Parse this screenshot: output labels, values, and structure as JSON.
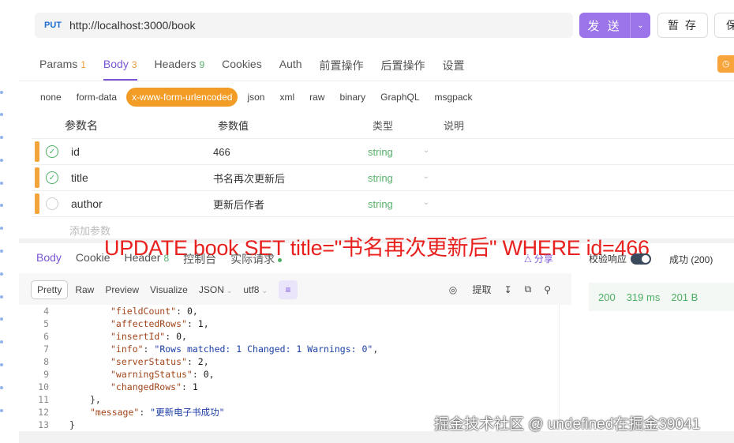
{
  "request": {
    "method": "PUT",
    "url": "http://localhost:3000/book",
    "send_label": "发 送",
    "save_label": "暂 存",
    "save2_label": "保"
  },
  "req_tabs": [
    {
      "label": "Params",
      "count": "1"
    },
    {
      "label": "Body",
      "count": "3"
    },
    {
      "label": "Headers",
      "count": "9"
    },
    {
      "label": "Cookies",
      "count": ""
    },
    {
      "label": "Auth",
      "count": ""
    },
    {
      "label": "前置操作",
      "count": ""
    },
    {
      "label": "后置操作",
      "count": ""
    },
    {
      "label": "设置",
      "count": ""
    }
  ],
  "body_types": [
    "none",
    "form-data",
    "x-www-form-urlencoded",
    "json",
    "xml",
    "raw",
    "binary",
    "GraphQL",
    "msgpack"
  ],
  "params_table": {
    "headers": {
      "name": "参数名",
      "value": "参数值",
      "type": "类型",
      "desc": "说明"
    },
    "rows": [
      {
        "name": "id",
        "value": "466",
        "type": "string",
        "checked": true
      },
      {
        "name": "title",
        "value": "书名再次更新后",
        "type": "string",
        "checked": true
      },
      {
        "name": "author",
        "value": "更新后作者",
        "type": "string",
        "checked": false
      }
    ],
    "add_placeholder": "添加参数"
  },
  "annotation": "UPDATE book SET title=\"书名再次更新后\" WHERE id=466",
  "resp_tabs": {
    "body": "Body",
    "cookie": "Cookie",
    "header": "Header",
    "header_count": "8",
    "console": "控制台",
    "actual": "实际请求",
    "share": "分享"
  },
  "validate": {
    "label": "校验响应",
    "status": "成功 (200)"
  },
  "view_bar": {
    "pretty": "Pretty",
    "raw": "Raw",
    "preview": "Preview",
    "visualize": "Visualize",
    "format": "JSON",
    "encoding": "utf8",
    "extract": "提取"
  },
  "code_lines": [
    {
      "n": "4",
      "indent": 2,
      "key": "fieldCount",
      "val": "0",
      "kind": "num",
      "comma": true
    },
    {
      "n": "5",
      "indent": 2,
      "key": "affectedRows",
      "val": "1",
      "kind": "num",
      "comma": true
    },
    {
      "n": "6",
      "indent": 2,
      "key": "insertId",
      "val": "0",
      "kind": "num",
      "comma": true
    },
    {
      "n": "7",
      "indent": 2,
      "key": "info",
      "val": "\"Rows matched: 1  Changed: 1  Warnings: 0\"",
      "kind": "str",
      "comma": true
    },
    {
      "n": "8",
      "indent": 2,
      "key": "serverStatus",
      "val": "2",
      "kind": "num",
      "comma": true
    },
    {
      "n": "9",
      "indent": 2,
      "key": "warningStatus",
      "val": "0",
      "kind": "num",
      "comma": true
    },
    {
      "n": "10",
      "indent": 2,
      "key": "changedRows",
      "val": "1",
      "kind": "num",
      "comma": false
    },
    {
      "n": "11",
      "indent": 1,
      "raw": "},"
    },
    {
      "n": "12",
      "indent": 1,
      "key": "message",
      "val": "\"更新电子书成功\"",
      "kind": "str",
      "comma": false
    },
    {
      "n": "13",
      "indent": 0,
      "raw": "}"
    }
  ],
  "stats": {
    "status": "200",
    "time": "319 ms",
    "size": "201 B"
  },
  "watermark": "掘金技术社区 @ undefined在掘金39041"
}
